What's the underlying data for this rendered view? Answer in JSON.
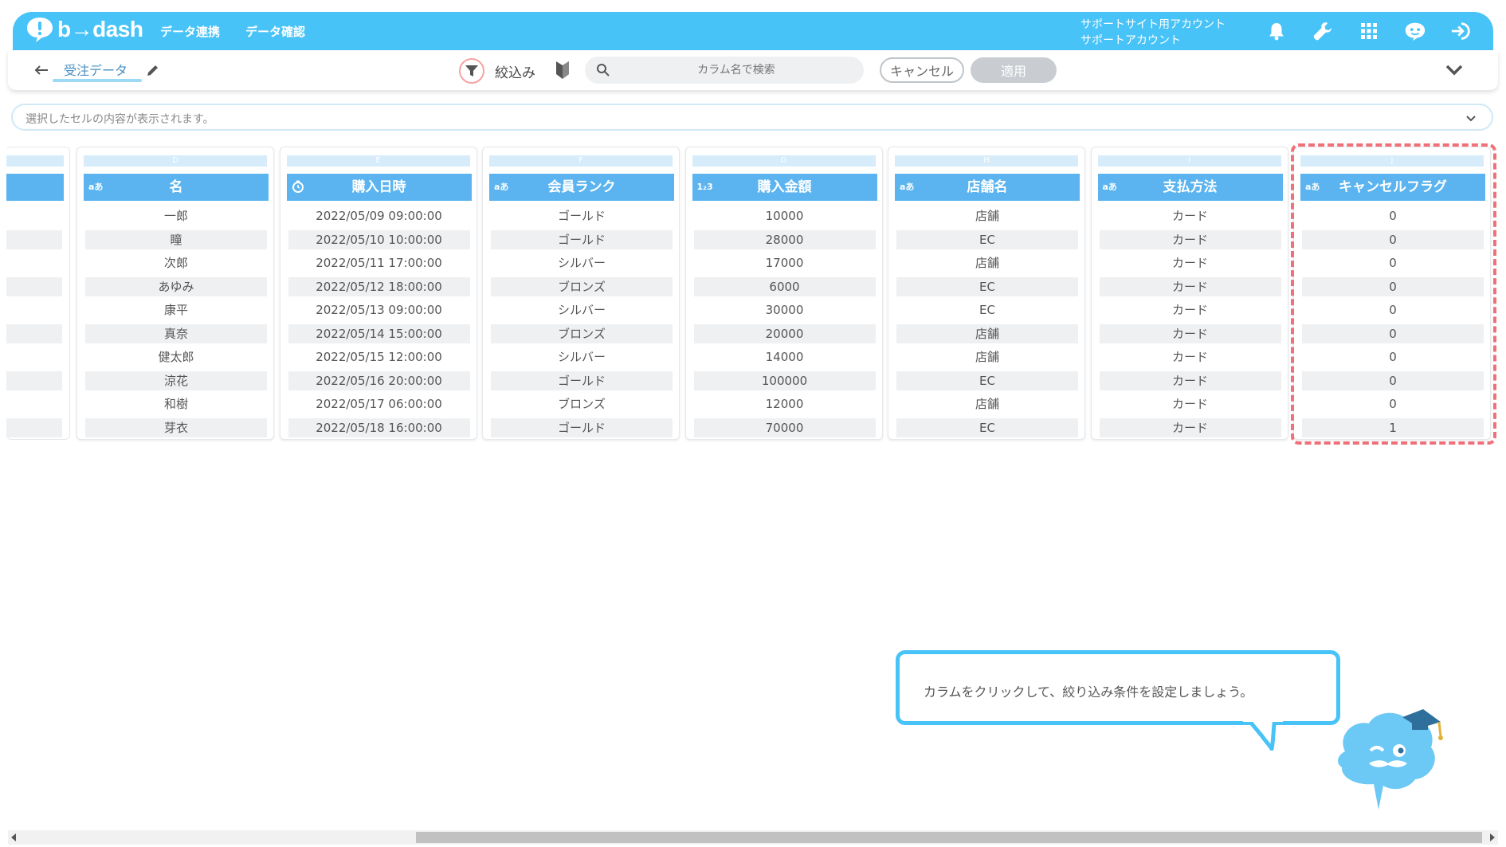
{
  "header": {
    "logo_text": "b→dash",
    "nav": [
      "データ連携",
      "データ確認"
    ],
    "account_line1": "サポートサイト用アカウント",
    "account_line2": "サポートアカウント",
    "icons": [
      "bell-icon",
      "wrench-icon",
      "grid-icon",
      "chatbot-icon",
      "logout-icon"
    ],
    "accent_color": "#48c3f7"
  },
  "subheader": {
    "title": "受注データ",
    "filter_label": "絞込み",
    "search_placeholder": "カラム名で検索",
    "cancel_label": "キャンセル",
    "apply_label": "適用"
  },
  "cellbar": {
    "placeholder": "選択したセルの内容が表示されます。"
  },
  "columns": [
    {
      "letter": "D",
      "type": "aあ",
      "name": "名",
      "values": [
        "一郎",
        "瞳",
        "次郎",
        "あゆみ",
        "康平",
        "真奈",
        "健太郎",
        "涼花",
        "和樹",
        "芽衣"
      ]
    },
    {
      "letter": "E",
      "type": "clock",
      "name": "購入日時",
      "values": [
        "2022/05/09 09:00:00",
        "2022/05/10 10:00:00",
        "2022/05/11 17:00:00",
        "2022/05/12 18:00:00",
        "2022/05/13 09:00:00",
        "2022/05/14 15:00:00",
        "2022/05/15 12:00:00",
        "2022/05/16 20:00:00",
        "2022/05/17 06:00:00",
        "2022/05/18 16:00:00"
      ]
    },
    {
      "letter": "F",
      "type": "aあ",
      "name": "会員ランク",
      "values": [
        "ゴールド",
        "ゴールド",
        "シルバー",
        "ブロンズ",
        "シルバー",
        "ブロンズ",
        "シルバー",
        "ゴールド",
        "ブロンズ",
        "ゴールド"
      ]
    },
    {
      "letter": "G",
      "type": "1₂3",
      "name": "購入金額",
      "values": [
        "10000",
        "28000",
        "17000",
        "6000",
        "30000",
        "20000",
        "14000",
        "100000",
        "12000",
        "70000"
      ]
    },
    {
      "letter": "H",
      "type": "aあ",
      "name": "店舗名",
      "values": [
        "店舗",
        "EC",
        "店舗",
        "EC",
        "EC",
        "店舗",
        "店舗",
        "EC",
        "店舗",
        "EC"
      ]
    },
    {
      "letter": "I",
      "type": "aあ",
      "name": "支払方法",
      "values": [
        "カード",
        "カード",
        "カード",
        "カード",
        "カード",
        "カード",
        "カード",
        "カード",
        "カード",
        "カード"
      ]
    },
    {
      "letter": "J",
      "type": "aあ",
      "name": "キャンセルフラグ",
      "values": [
        "0",
        "0",
        "0",
        "0",
        "0",
        "0",
        "0",
        "0",
        "0",
        "1"
      ]
    }
  ],
  "tooltip": {
    "message": "カラムをクリックして、絞り込み条件を設定しましょう。"
  }
}
